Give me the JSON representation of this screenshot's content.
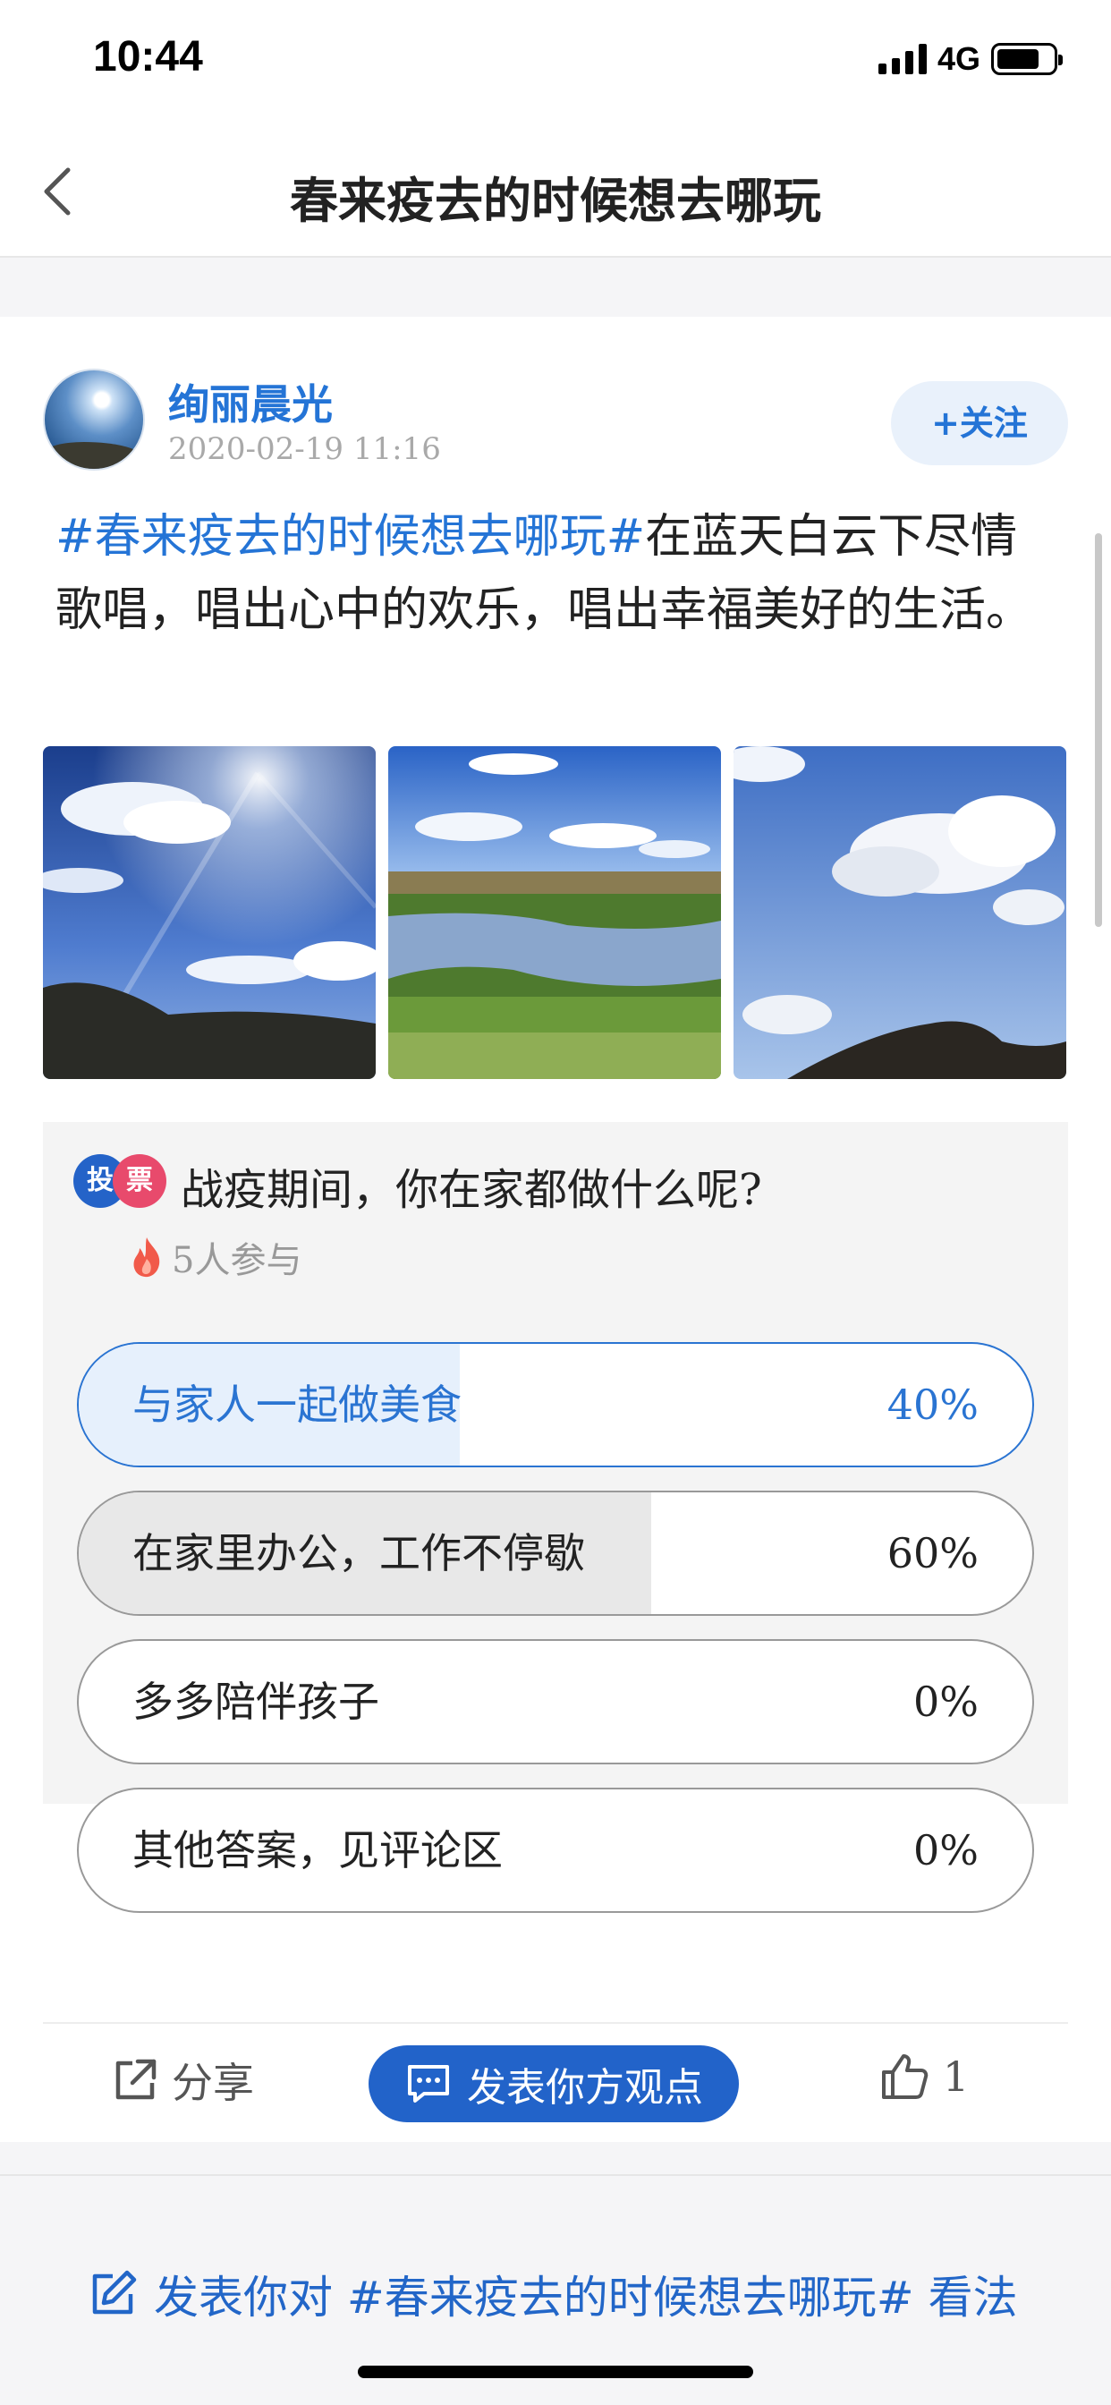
{
  "status_bar": {
    "time": "10:44",
    "network": "4G"
  },
  "nav": {
    "title": "春来疫去的时候想去哪玩"
  },
  "post": {
    "author": "绚丽晨光",
    "time": "2020-02-19  11:16",
    "follow_label": "+关注",
    "topic": "#春来疫去的时候想去哪玩#",
    "body": "在蓝天白云下尽情歌唱，唱出心中的欢乐，唱出幸福美好的生活。",
    "photos": [
      "sky-clouds-sun-photo",
      "wetland-grassland-photo",
      "cloud-hill-photo"
    ]
  },
  "poll": {
    "badge_left": "投",
    "badge_right": "票",
    "question": "战疫期间，你在家都做什么呢?",
    "participants": "5人参与",
    "options": [
      {
        "label": "与家人一起做美食",
        "percent_text": "40%",
        "percent": 40,
        "selected": true
      },
      {
        "label": "在家里办公，工作不停歇",
        "percent_text": "60%",
        "percent": 60,
        "selected": false
      },
      {
        "label": "多多陪伴孩子",
        "percent_text": "0%",
        "percent": 0,
        "selected": false
      },
      {
        "label": "其他答案，见评论区",
        "percent_text": "0%",
        "percent": 0,
        "selected": false
      }
    ]
  },
  "actions": {
    "share_label": "分享",
    "comment_label": "发表你方观点",
    "like_count": "1"
  },
  "composer": {
    "text": "发表你对 #春来疫去的时候想去哪玩# 看法"
  },
  "colors": {
    "accent": "#2474d6",
    "button_blue": "#2263c9",
    "badge_blue": "#2463c8",
    "badge_pink": "#e84a6c"
  }
}
